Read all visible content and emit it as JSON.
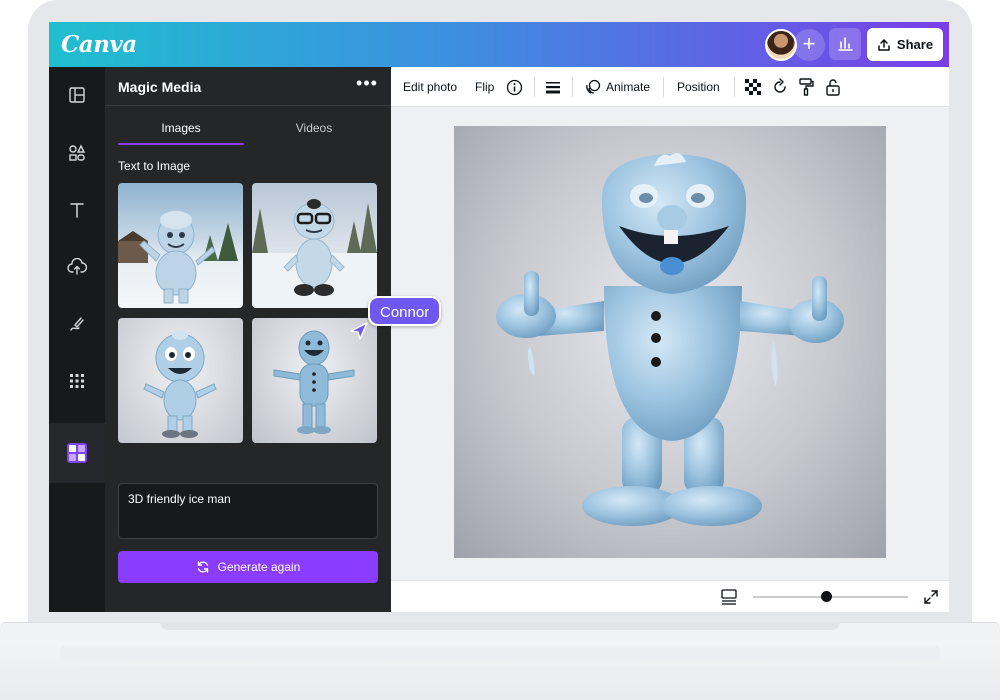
{
  "app": {
    "brand": "Canva"
  },
  "header": {
    "share_label": "Share"
  },
  "side_panel": {
    "title": "Magic Media",
    "more_label": "•••",
    "tabs": [
      {
        "label": "Images"
      },
      {
        "label": "Videos"
      }
    ],
    "section_label": "Text to Image",
    "prompt_value": "3D friendly ice man",
    "generate_label": "Generate again"
  },
  "toolbar": {
    "edit_photo": "Edit photo",
    "flip": "Flip",
    "animate": "Animate",
    "position": "Position"
  },
  "collaborator": {
    "name": "Connor"
  },
  "zoom": {
    "level_fraction": 0.47
  },
  "colors": {
    "accent": "#8b3dff",
    "cursor_tag": "#6f58f0",
    "topbar_start": "#1fbfcf",
    "topbar_end": "#7a3fe8"
  },
  "icons": {
    "rail": [
      "layout-icon",
      "elements-icon",
      "text-icon",
      "upload-icon",
      "draw-icon",
      "apps-icon",
      "magic-media-icon"
    ],
    "toolbar": [
      "info-icon",
      "lines-icon",
      "animate-icon",
      "transparency-icon",
      "rotate-icon",
      "paint-roller-icon",
      "lock-icon"
    ]
  }
}
